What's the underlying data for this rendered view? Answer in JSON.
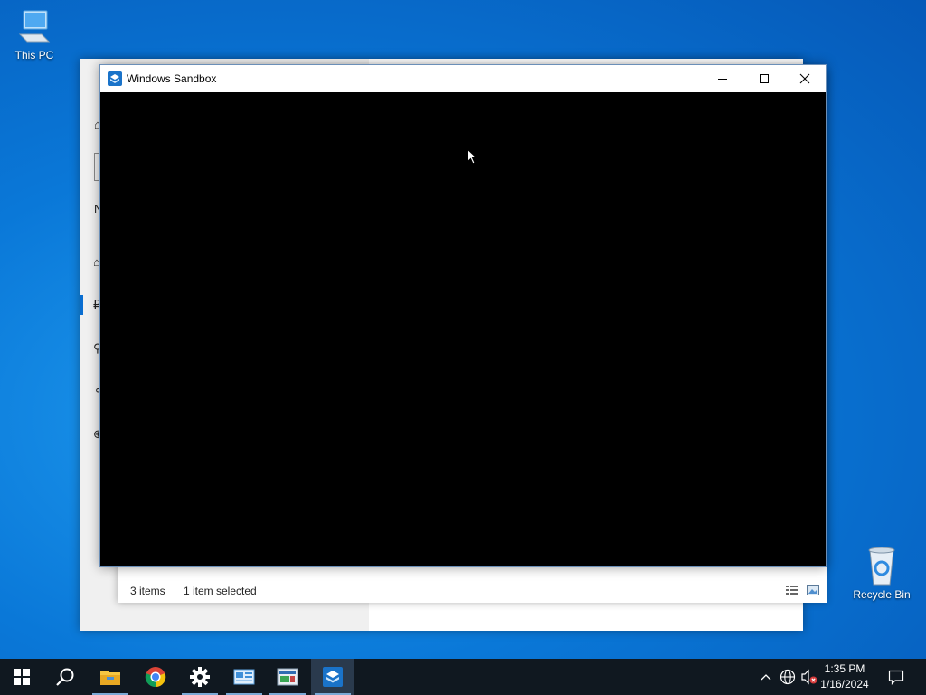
{
  "desktop": {
    "icons": [
      {
        "label": "This PC",
        "icon": "computer-icon"
      },
      {
        "label": "Recycle Bin",
        "icon": "recycle-bin-icon"
      }
    ]
  },
  "settings_window": {
    "sidebar_glyphs": [
      "⌂",
      "N",
      "⌂",
      "₽",
      "⚲",
      "⚬",
      "⊕"
    ]
  },
  "explorer_window": {
    "status": {
      "item_count": "3 items",
      "selection": "1 item selected"
    }
  },
  "sandbox_window": {
    "title": "Windows Sandbox",
    "icon": "sandbox-icon",
    "buttons": {
      "minimize": "minimize-icon",
      "maximize": "maximize-icon",
      "close": "close-icon"
    }
  },
  "taskbar": {
    "items": [
      {
        "name": "start",
        "icon": "windows-logo-icon"
      },
      {
        "name": "search",
        "icon": "search-icon"
      },
      {
        "name": "file-explorer",
        "icon": "folder-icon"
      },
      {
        "name": "chrome",
        "icon": "chrome-icon"
      },
      {
        "name": "settings",
        "icon": "gear-icon"
      },
      {
        "name": "control-panel",
        "icon": "control-panel-icon"
      },
      {
        "name": "app",
        "icon": "app-icon"
      },
      {
        "name": "windows-sandbox",
        "icon": "sandbox-icon",
        "active": true
      }
    ],
    "tray": {
      "icons": [
        "chevron-up-icon",
        "network-icon",
        "volume-muted-icon"
      ],
      "time": "1:35 PM",
      "date": "1/16/2024",
      "notification_icon": "notification-icon"
    }
  },
  "colors": {
    "accent": "#0a6ed1",
    "taskbar": "#101820",
    "sandbox_body": "#000000"
  }
}
